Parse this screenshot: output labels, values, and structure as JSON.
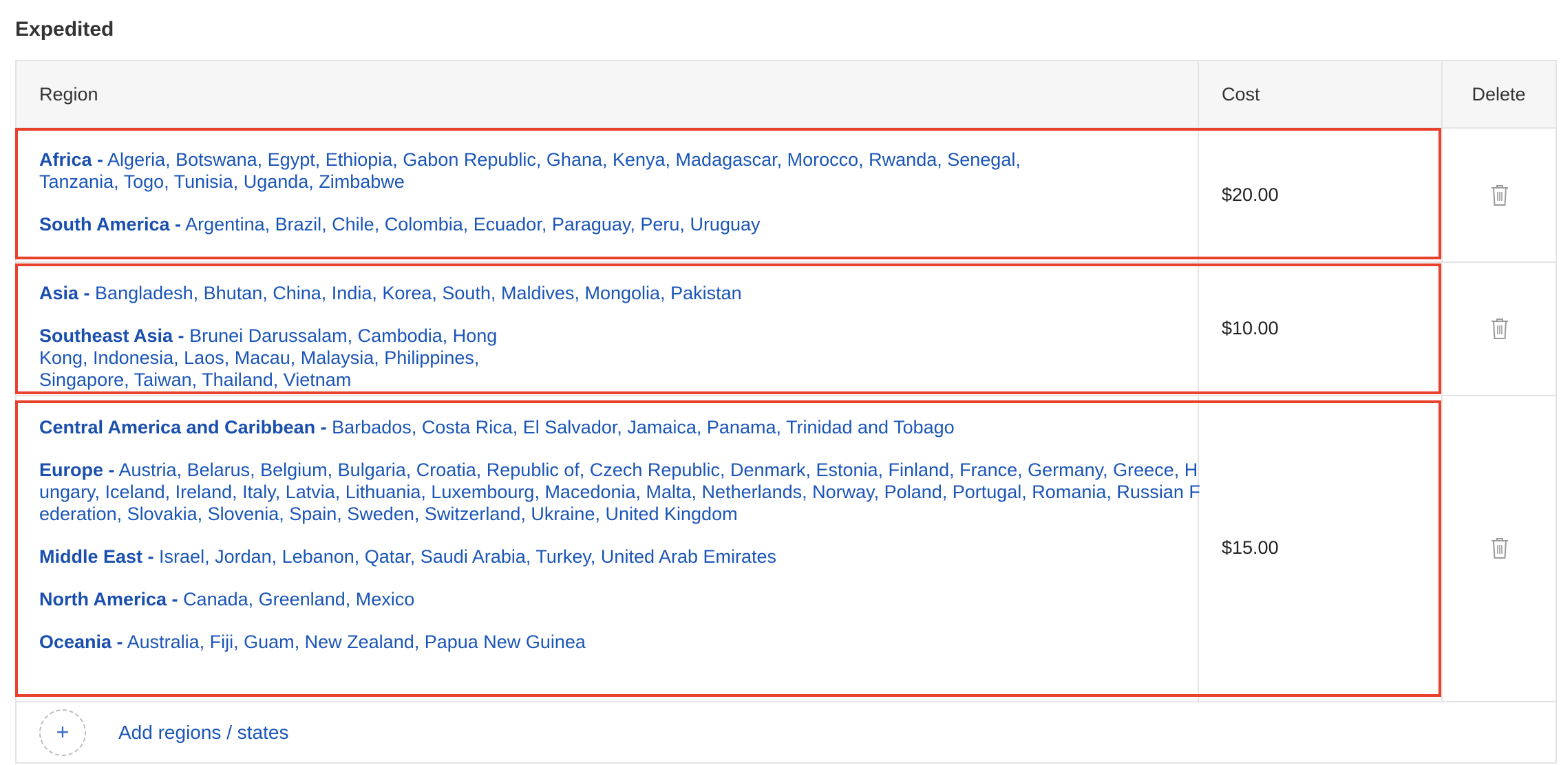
{
  "section": {
    "title": "Expedited"
  },
  "table": {
    "headers": {
      "region": "Region",
      "cost": "Cost",
      "delete": "Delete"
    },
    "rows": [
      {
        "cost": "$20.00",
        "groups": [
          {
            "name": "Africa -",
            "countries": "Algeria, Botswana, Egypt, Ethiopia, Gabon Republic, Ghana, Kenya, Madagascar, Morocco, Rwanda, Senegal, Tanzania, Togo, Tunisia, Uganda, Zimbabwe"
          },
          {
            "name": "South America -",
            "countries": "Argentina, Brazil, Chile, Colombia, Ecuador, Paraguay, Peru, Uruguay"
          }
        ]
      },
      {
        "cost": "$10.00",
        "groups": [
          {
            "name": "Asia -",
            "countries": "Bangladesh, Bhutan, China, India, Korea, South, Maldives, Mongolia, Pakistan"
          },
          {
            "name": "Southeast Asia -",
            "countries": "Brunei Darussalam, Cambodia, Hong Kong, Indonesia, Laos, Macau, Malaysia, Philippines, Singapore, Taiwan, Thailand, Vietnam"
          }
        ]
      },
      {
        "cost": "$15.00",
        "groups": [
          {
            "name": "Central America and Caribbean -",
            "countries": "Barbados, Costa Rica, El Salvador, Jamaica, Panama, Trinidad and Tobago"
          },
          {
            "name": "Europe -",
            "countries": "Austria, Belarus, Belgium, Bulgaria, Croatia, Republic of, Czech Republic, Denmark, Estonia, Finland, France, Germany, Greece, Hungary, Iceland, Ireland, Italy, Latvia, Lithuania, Luxembourg, Macedonia, Malta, Netherlands, Norway, Poland, Portugal, Romania, Russian Federation, Slovakia, Slovenia, Spain, Sweden, Switzerland, Ukraine, United Kingdom"
          },
          {
            "name": "Middle East -",
            "countries": "Israel, Jordan, Lebanon, Qatar, Saudi Arabia, Turkey, United Arab Emirates"
          },
          {
            "name": "North America -",
            "countries": "Canada, Greenland, Mexico"
          },
          {
            "name": "Oceania -",
            "countries": "Australia, Fiji, Guam, New Zealand, Papua New Guinea"
          }
        ]
      }
    ],
    "add_label": "Add regions / states",
    "add_icon": "plus-icon",
    "delete_icon": "trash-icon"
  },
  "colors": {
    "highlight": "#e8412c",
    "link": "#1a55b8"
  }
}
